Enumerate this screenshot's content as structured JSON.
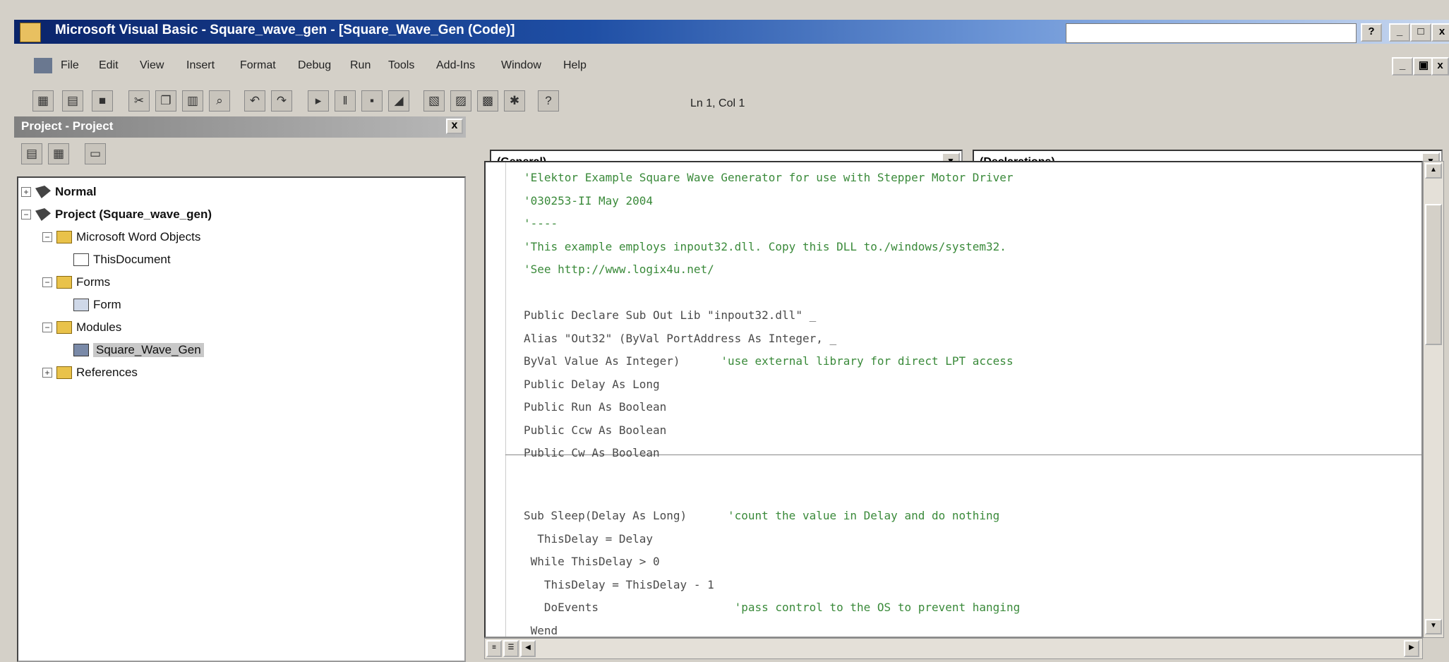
{
  "window": {
    "title": "Microsoft Visual Basic - Square_wave_gen - [Square_Wave_Gen (Code)]",
    "search_value": "",
    "buttons": {
      "help": "?",
      "minimize": "_",
      "maximize": "□",
      "close": "x"
    }
  },
  "menubar": {
    "items": [
      "File",
      "Edit",
      "View",
      "Insert",
      "Format",
      "Debug",
      "Run",
      "Tools",
      "Add-Ins",
      "Window",
      "Help"
    ],
    "doc_buttons": {
      "minimize": "_",
      "restore": "▣",
      "close": "x"
    }
  },
  "toolbar": {
    "cursor_position": "Ln 1, Col 1"
  },
  "project_panel": {
    "title": "Project - Project",
    "close": "x",
    "tree": [
      {
        "label": "Normal",
        "bold": true
      },
      {
        "label": "Project (Square_wave_gen)",
        "bold": true
      },
      {
        "label": "Microsoft Word Objects"
      },
      {
        "label": "ThisDocument"
      },
      {
        "label": "Forms"
      },
      {
        "label": "Form"
      },
      {
        "label": "Modules"
      },
      {
        "label": "Square_Wave_Gen"
      },
      {
        "label": "References"
      }
    ]
  },
  "code_window": {
    "object_combo": "(General)",
    "procedure_combo": "(Declarations)",
    "lines": [
      {
        "code": "",
        "comment": "'Elektor Example Square Wave Generator for use with Stepper Motor Driver"
      },
      {
        "code": "",
        "comment": "'030253-II May 2004"
      },
      {
        "code": "",
        "comment": "'----"
      },
      {
        "code": "",
        "comment": "'This example employs inpout32.dll. Copy this DLL to./windows/system32."
      },
      {
        "code": "",
        "comment": "'See http://www.logix4u.net/"
      },
      {
        "code": "",
        "comment": ""
      },
      {
        "code": "Public Declare Sub Out Lib \"inpout32.dll\" _",
        "comment": ""
      },
      {
        "code": "Alias \"Out32\" (ByVal PortAddress As Integer, _",
        "comment": ""
      },
      {
        "code": "ByVal Value As Integer)      ",
        "comment": "'use external library for direct LPT access"
      },
      {
        "code": "Public Delay As Long",
        "comment": ""
      },
      {
        "code": "Public Run As Boolean",
        "comment": ""
      },
      {
        "code": "Public Ccw As Boolean",
        "comment": ""
      },
      {
        "code": "Public Cw As Boolean",
        "comment": ""
      },
      {
        "code": "",
        "comment": ""
      },
      {
        "code": "Sub Sleep(Delay As Long)      ",
        "comment": "'count the value in Delay and do nothing"
      },
      {
        "code": "  ThisDelay = Delay",
        "comment": ""
      },
      {
        "code": " While ThisDelay > 0",
        "comment": ""
      },
      {
        "code": "   ThisDelay = ThisDelay - 1",
        "comment": ""
      },
      {
        "code": "   DoEvents                    ",
        "comment": "'pass control to the OS to prevent hanging"
      },
      {
        "code": " Wend",
        "comment": ""
      }
    ]
  },
  "colors": {
    "titlebar_start": "#0a246a",
    "comment": "#3a8a3a",
    "code_text": "#4a4a4a"
  }
}
